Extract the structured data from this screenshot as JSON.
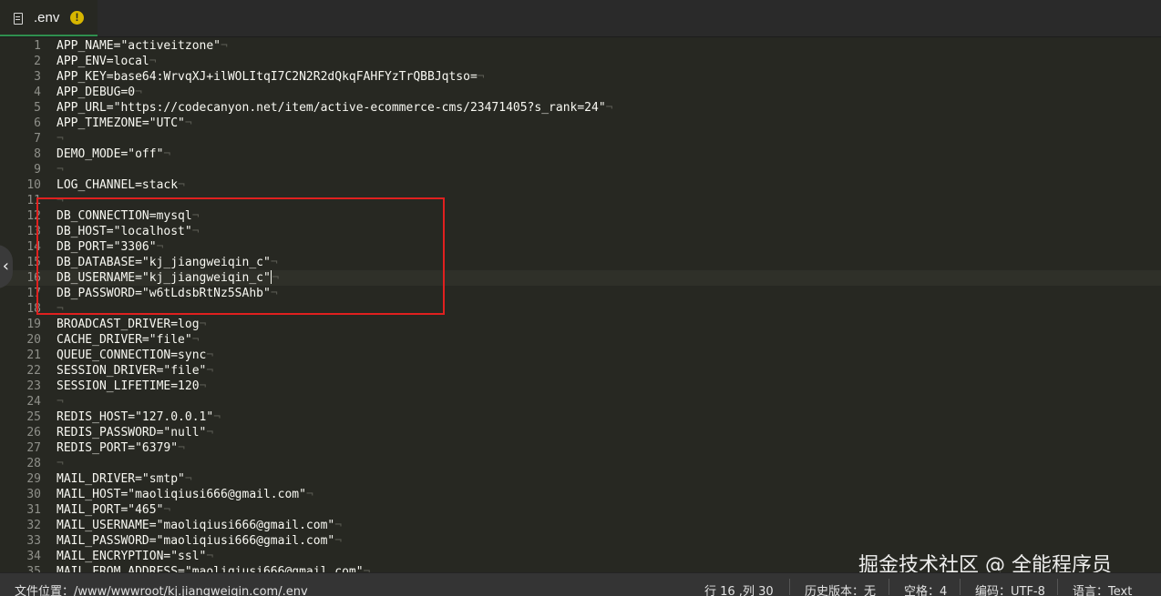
{
  "tab": {
    "filename": ".env",
    "warning_symbol": "!",
    "file_icon": "file-icon",
    "warn_icon": "warning-icon"
  },
  "editor": {
    "eol_marker": "¬",
    "lines": [
      {
        "num": "1",
        "text": "APP_NAME=\"activeitzone\""
      },
      {
        "num": "2",
        "text": "APP_ENV=local"
      },
      {
        "num": "3",
        "text": "APP_KEY=base64:WrvqXJ+ilWOLItqI7C2N2R2dQkqFAHFYzTrQBBJqtso="
      },
      {
        "num": "4",
        "text": "APP_DEBUG=0"
      },
      {
        "num": "5",
        "text": "APP_URL=\"https://codecanyon.net/item/active-ecommerce-cms/23471405?s_rank=24\""
      },
      {
        "num": "6",
        "text": "APP_TIMEZONE=\"UTC\""
      },
      {
        "num": "7",
        "text": ""
      },
      {
        "num": "8",
        "text": "DEMO_MODE=\"off\""
      },
      {
        "num": "9",
        "text": ""
      },
      {
        "num": "10",
        "text": "LOG_CHANNEL=stack"
      },
      {
        "num": "11",
        "text": ""
      },
      {
        "num": "12",
        "text": "DB_CONNECTION=mysql"
      },
      {
        "num": "13",
        "text": "DB_HOST=\"localhost\""
      },
      {
        "num": "14",
        "text": "DB_PORT=\"3306\""
      },
      {
        "num": "15",
        "text": "DB_DATABASE=\"kj_jiangweiqin_c\""
      },
      {
        "num": "16",
        "text": "DB_USERNAME=\"kj_jiangweiqin_c\""
      },
      {
        "num": "17",
        "text": "DB_PASSWORD=\"w6tLdsbRtNz5SAhb\""
      },
      {
        "num": "18",
        "text": ""
      },
      {
        "num": "19",
        "text": "BROADCAST_DRIVER=log"
      },
      {
        "num": "20",
        "text": "CACHE_DRIVER=\"file\""
      },
      {
        "num": "21",
        "text": "QUEUE_CONNECTION=sync"
      },
      {
        "num": "22",
        "text": "SESSION_DRIVER=\"file\""
      },
      {
        "num": "23",
        "text": "SESSION_LIFETIME=120"
      },
      {
        "num": "24",
        "text": ""
      },
      {
        "num": "25",
        "text": "REDIS_HOST=\"127.0.0.1\""
      },
      {
        "num": "26",
        "text": "REDIS_PASSWORD=\"null\""
      },
      {
        "num": "27",
        "text": "REDIS_PORT=\"6379\""
      },
      {
        "num": "28",
        "text": ""
      },
      {
        "num": "29",
        "text": "MAIL_DRIVER=\"smtp\""
      },
      {
        "num": "30",
        "text": "MAIL_HOST=\"maoliqiusi666@gmail.com\""
      },
      {
        "num": "31",
        "text": "MAIL_PORT=\"465\""
      },
      {
        "num": "32",
        "text": "MAIL_USERNAME=\"maoliqiusi666@gmail.com\""
      },
      {
        "num": "33",
        "text": "MAIL_PASSWORD=\"maoliqiusi666@gmail.com\""
      },
      {
        "num": "34",
        "text": "MAIL_ENCRYPTION=\"ssl\""
      },
      {
        "num": "35",
        "text": "MAIL_FROM_ADDRESS=\"maoliqiusi666@gmail.com\""
      }
    ],
    "current_line": 16,
    "side_arrow_icon": "chevron-left-icon",
    "side_arrow_symbol": "‹"
  },
  "statusbar": {
    "file_location": "文件位置：/www/wwwroot/kj.jiangweiqin.com/.env",
    "cursor_position": "行 16 ,列 30",
    "history": "历史版本：无",
    "indent": "空格：4",
    "encoding": "编码：UTF-8",
    "language": "语言：Text"
  },
  "watermark": "掘金技术社区 @ 全能程序员",
  "colors": {
    "editor_bg": "#272822",
    "highlight_box": "#e0201f",
    "warning": "#d7b600",
    "tab_accent": "#2f8f4e"
  }
}
